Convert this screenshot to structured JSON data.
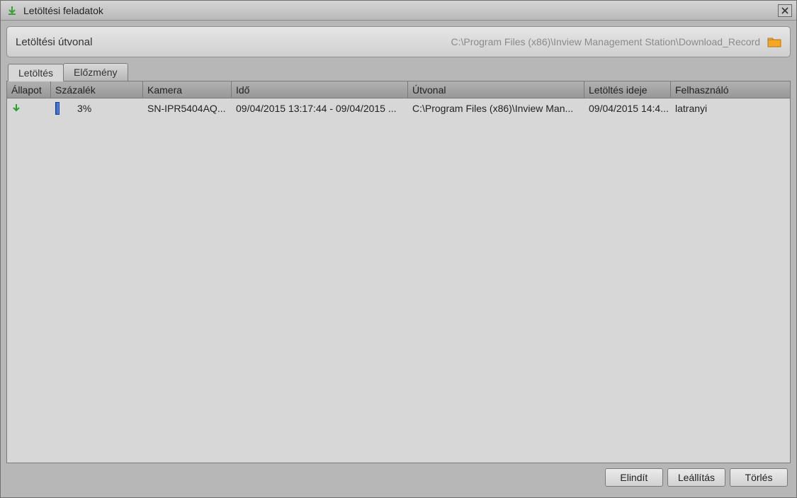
{
  "window": {
    "title": "Letöltési feladatok"
  },
  "pathbox": {
    "label": "Letöltési útvonal",
    "path": "C:\\Program Files (x86)\\Inview Management Station\\Download_Record"
  },
  "tabs": {
    "download": "Letöltés",
    "history": "Előzmény"
  },
  "columns": {
    "status": "Állapot",
    "percent": "Százalék",
    "camera": "Kamera",
    "time": "Idő",
    "path": "Útvonal",
    "dltime": "Letöltés ideje",
    "user": "Felhasználó"
  },
  "rows": [
    {
      "status": "downloading",
      "percent": "3%",
      "camera": "SN-IPR5404AQ...",
      "time": "09/04/2015 13:17:44 - 09/04/2015 ...",
      "path": "C:\\Program Files (x86)\\Inview Man...",
      "dltime": "09/04/2015 14:4...",
      "user": "latranyi"
    }
  ],
  "buttons": {
    "start": "Elindít",
    "stop": "Leállítás",
    "delete": "Törlés"
  }
}
